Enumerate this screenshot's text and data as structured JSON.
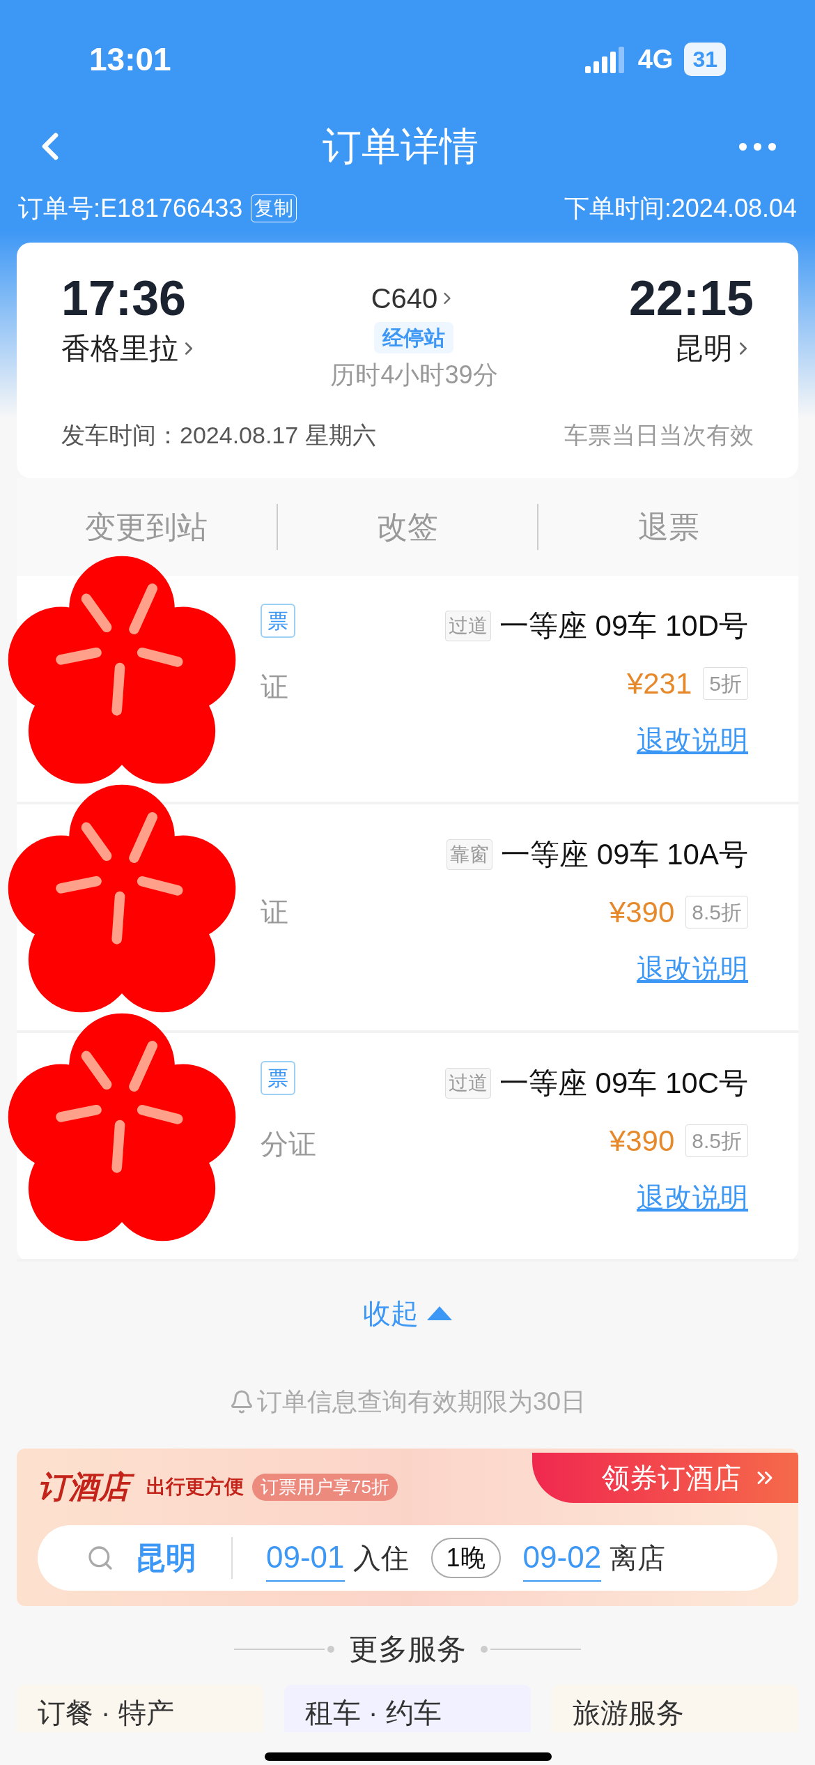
{
  "status_bar": {
    "time": "13:01",
    "network": "4G",
    "battery": "31"
  },
  "nav": {
    "title": "订单详情"
  },
  "order": {
    "number": "订单号:E181766433",
    "copy": "复制",
    "placed": "下单时间:2024.08.04"
  },
  "trip": {
    "depart_time": "17:36",
    "depart_station": "香格里拉",
    "train": "C640",
    "stops": "经停站",
    "duration": "历时4小时39分",
    "arrive_time": "22:15",
    "arrive_station": "昆明",
    "date": "发车时间：2024.08.17 星期六",
    "validity": "车票当日当次有效"
  },
  "actions": [
    "变更到站",
    "改签",
    "退票"
  ],
  "passengers": [
    {
      "badge": "票",
      "id": "证",
      "seat_tag": "过道",
      "seat": "一等座 09车 10D号",
      "price": "¥231",
      "discount": "5折",
      "rules": "退改说明"
    },
    {
      "id": "证",
      "seat_tag": "靠窗",
      "seat": "一等座 09车 10A号",
      "price": "¥390",
      "discount": "8.5折",
      "rules": "退改说明"
    },
    {
      "badge": "票",
      "id": "分证",
      "seat_tag": "过道",
      "seat": "一等座 09车 10C号",
      "price": "¥390",
      "discount": "8.5折",
      "rules": "退改说明"
    }
  ],
  "collapse": "收起",
  "notice": "订单信息查询有效期限为30日",
  "hotel": {
    "logo": "订酒店",
    "slogan": "出行更方便",
    "promo": "订票用户享75折",
    "cta": "领券订酒店",
    "city": "昆明",
    "checkin": "09-01",
    "checkin_label": "入住",
    "nights": "1晚",
    "checkout": "09-02",
    "checkout_label": "离店"
  },
  "more": {
    "title": "更多服务",
    "items": [
      "订餐 · 特产",
      "租车 · 约车",
      "旅游服务"
    ]
  }
}
